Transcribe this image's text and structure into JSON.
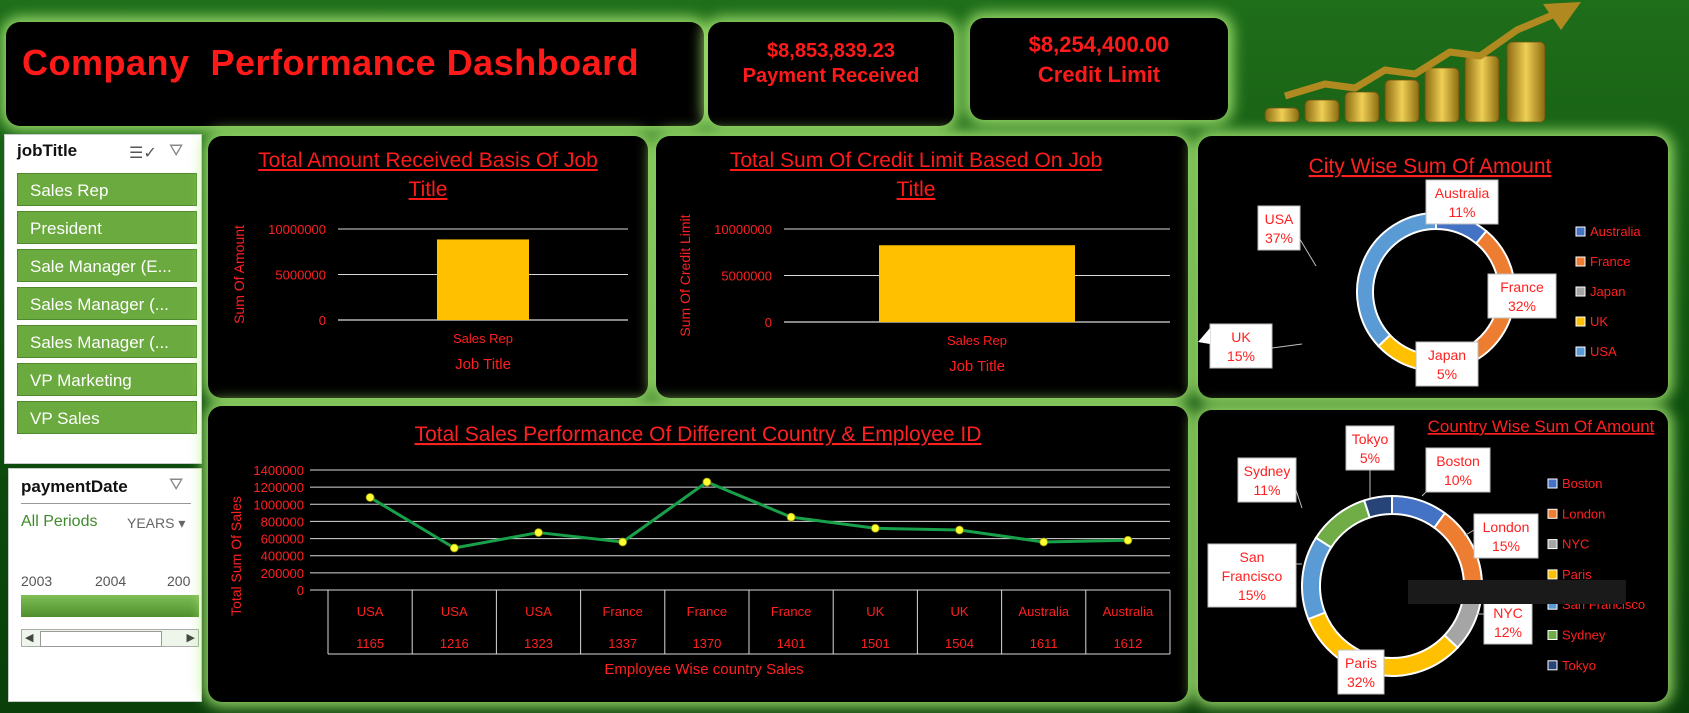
{
  "dashboard": {
    "title": "Company  Performance Dashboard",
    "kpi_payment": {
      "value": "$8,853,839.23",
      "label": "Payment Received"
    },
    "kpi_credit": {
      "value": "$8,254,400.00",
      "label": "Credit Limit"
    }
  },
  "slicer_job": {
    "title": "jobTitle",
    "items": [
      "Sales Rep",
      "President",
      "Sale Manager (E...",
      "Sales Manager (...",
      "Sales Manager (...",
      "VP Marketing",
      "VP Sales"
    ]
  },
  "slicer_date": {
    "title": "paymentDate",
    "period": "All Periods",
    "level": "YEARS",
    "years": [
      "2003",
      "2004",
      "200"
    ]
  },
  "colors": {
    "accent": "#ff1a1a",
    "bar": "#ffc000",
    "line": "#19a04a",
    "panel": "#000000",
    "glow": "#afee78"
  },
  "chart_data": [
    {
      "type": "bar",
      "title": "Total Amount Received Basis Of Job Title",
      "categories": [
        "Sales Rep"
      ],
      "values": [
        8853839
      ],
      "xlabel": "Job Title",
      "ylabel": "Sum Of Amount",
      "yticks": [
        "0",
        "5000000",
        "10000000"
      ],
      "ylim": [
        0,
        10000000
      ]
    },
    {
      "type": "bar",
      "title": "Total Sum Of Credit Limit Based On Job Title",
      "categories": [
        "Sales Rep"
      ],
      "values": [
        8254400
      ],
      "xlabel": "Job Title",
      "ylabel": "Sum Of Credit Limit",
      "yticks": [
        "0",
        "5000000",
        "10000000"
      ],
      "ylim": [
        0,
        10000000
      ]
    },
    {
      "type": "pie",
      "title": "City Wise  Sum Of Amount",
      "labels": [
        "Australia",
        "France",
        "Japan",
        "UK",
        "USA"
      ],
      "values": [
        11,
        32,
        5,
        15,
        37
      ],
      "colors": [
        "#4472c4",
        "#ed7d31",
        "#a5a5a5",
        "#ffc000",
        "#5b9bd5"
      ],
      "legend": "right"
    },
    {
      "type": "line",
      "title": "Total Sales Performance Of Different Country &  Employee ID",
      "countries": [
        "USA",
        "USA",
        "USA",
        "France",
        "France",
        "France",
        "UK",
        "UK",
        "Australia",
        "Australia"
      ],
      "employee_ids": [
        "1165",
        "1216",
        "1323",
        "1337",
        "1370",
        "1401",
        "1501",
        "1504",
        "1611",
        "1612"
      ],
      "values": [
        1080000,
        490000,
        670000,
        560000,
        1260000,
        850000,
        720000,
        700000,
        560000,
        580000
      ],
      "xlabel": "Employee Wise country Sales",
      "ylabel": "Total  Sum Of Sales",
      "yticks": [
        "0",
        "200000",
        "400000",
        "600000",
        "800000",
        "1000000",
        "1200000",
        "1400000"
      ],
      "ylim": [
        0,
        1400000
      ],
      "grid": true
    },
    {
      "type": "pie",
      "title": "Country Wise Sum Of Amount",
      "labels": [
        "Boston",
        "London",
        "NYC",
        "Paris",
        "San Francisco",
        "Sydney",
        "Tokyo"
      ],
      "values": [
        10,
        15,
        12,
        32,
        15,
        11,
        5
      ],
      "colors": [
        "#4472c4",
        "#ed7d31",
        "#a5a5a5",
        "#ffc000",
        "#5b9bd5",
        "#70ad47",
        "#264478"
      ],
      "legend": "right"
    }
  ]
}
